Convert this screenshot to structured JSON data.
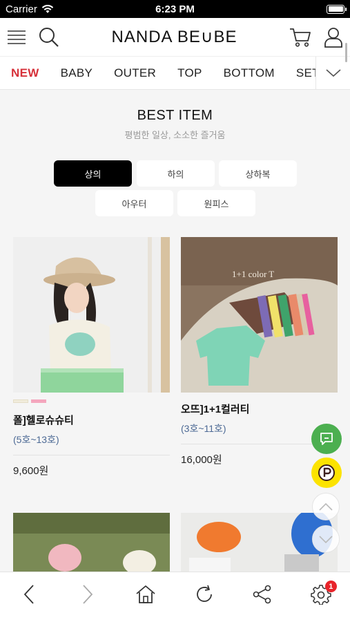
{
  "status_bar": {
    "carrier": "Carrier",
    "time": "6:23 PM"
  },
  "header": {
    "logo": "NANDA BE∪BE"
  },
  "category_nav": {
    "items": [
      "NEW",
      "BABY",
      "OUTER",
      "TOP",
      "BOTTOM",
      "SET/OP"
    ]
  },
  "section": {
    "title": "BEST ITEM",
    "subtitle": "평범한 일상, 소소한 즐거움"
  },
  "tabs": [
    "상의",
    "하의",
    "상하복",
    "아우터",
    "원피스"
  ],
  "products": [
    {
      "name": "폴]헬로슈슈티",
      "size": "(5호~13호)",
      "price": "9,600원",
      "swatch_colors": [
        "#f1ecdc",
        "#f4a6bd"
      ]
    },
    {
      "name": "오뜨]1+1컬러티",
      "size": "(3호~11호)",
      "price": "16,000원",
      "image_caption": "1+1 color T"
    }
  ],
  "bottom_bar": {
    "settings_badge": "1"
  },
  "colors": {
    "accent_red": "#d6313a",
    "size_blue": "#4d6a95",
    "talk_green": "#4caf50",
    "kakao_yellow": "#fce300"
  }
}
